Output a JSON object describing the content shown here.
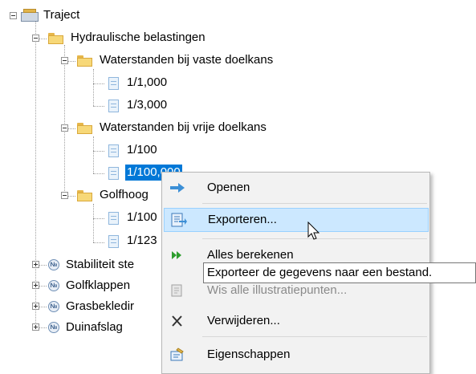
{
  "tree": {
    "root": "Traject",
    "hydraulic": "Hydraulische belastingen",
    "fixed_group": "Waterstanden bij vaste doelkans",
    "fixed_items": [
      "1/1,000",
      "1/3,000"
    ],
    "free_group": "Waterstanden bij vrije doelkans",
    "free_items": [
      "1/100",
      "1/100,000"
    ],
    "wave_group": "Golfhoog",
    "wave_items": [
      "1/100",
      "1/123"
    ],
    "failure_items": [
      "Stabiliteit ste",
      "Golfklappen",
      "Grasbekledir",
      "Duinafslag"
    ]
  },
  "context_menu": {
    "items": [
      "Openen",
      "Exporteren...",
      "Alles berekenen",
      "Wis alle illustratiepunten...",
      "Verwijderen...",
      "Eigenschappen"
    ]
  },
  "tooltip": "Exporteer de gegevens naar een bestand.",
  "colors": {
    "selection": "#0078d7",
    "menu_hover": "#cce8ff",
    "menu_bg": "#f2f2f2"
  }
}
